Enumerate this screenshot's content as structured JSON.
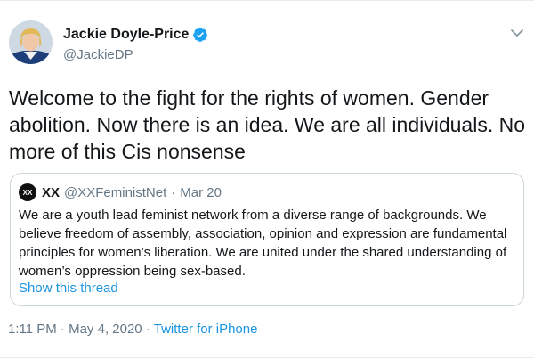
{
  "author": {
    "name": "Jackie Doyle-Price",
    "handle": "@JackieDP"
  },
  "tweet": {
    "text": "Welcome to the fight for the rights of women. Gender abolition. Now there is an idea. We are all individuals. No more of this Cis nonsense"
  },
  "quote": {
    "avatar_text": "XX",
    "name": "XX",
    "handle": "@XXFeministNet",
    "separator": "·",
    "date": "Mar 20",
    "text": "We are a youth lead feminist network from a diverse range of backgrounds. We believe freedom of assembly, association, opinion and expression are fundamental principles for women’s liberation. We are united under the shared understanding of women’s oppression being sex-based.",
    "show_thread": "Show this thread"
  },
  "meta": {
    "time": "1:11 PM",
    "separator1": "·",
    "date": "May 4, 2020",
    "separator2": "·",
    "source": "Twitter for iPhone"
  },
  "colors": {
    "accent": "#1b95e0",
    "secondary_text": "#657786",
    "border": "#ccd6dd"
  },
  "icons": [
    "verified-badge-icon",
    "chevron-down-icon"
  ]
}
